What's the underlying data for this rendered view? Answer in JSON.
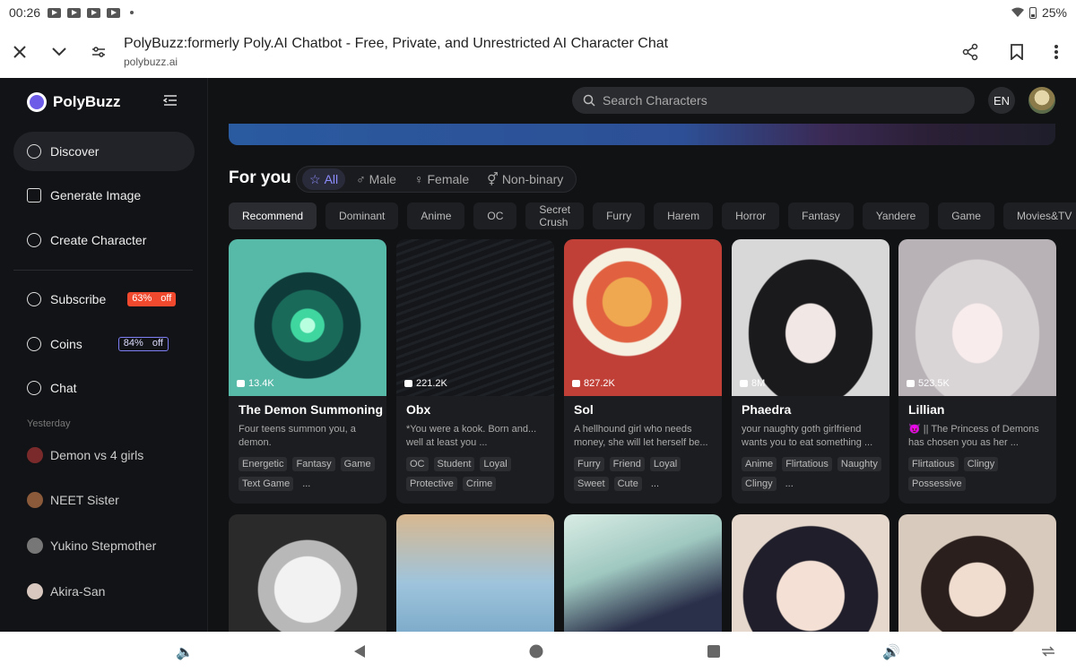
{
  "statusbar": {
    "time": "00:26",
    "battery": "25%"
  },
  "browser": {
    "title": "PolyBuzz:formerly Poly.AI Chatbot - Free, Private, and Unrestricted AI Character Chat",
    "domain": "polybuzz.ai"
  },
  "sidebar": {
    "logo": "PolyBuzz",
    "nav": [
      {
        "label": "Discover",
        "icon": "compass-icon"
      },
      {
        "label": "Generate Image",
        "icon": "image-plus-icon"
      },
      {
        "label": "Create Character",
        "icon": "user-plus-icon"
      }
    ],
    "subscribe": {
      "label": "Subscribe",
      "badge_num": "63%",
      "badge_off": "off"
    },
    "coins": {
      "label": "Coins",
      "badge_num": "84%",
      "badge_off": "off"
    },
    "chat": {
      "label": "Chat"
    },
    "section_label": "Yesterday",
    "chats": [
      {
        "name": "Demon vs 4 girls",
        "color": "#7a2a2a"
      },
      {
        "name": "NEET Sister",
        "color": "#8a5a3a"
      },
      {
        "name": "Yukino Stepmother",
        "color": "#777777"
      },
      {
        "name": "Akira-San",
        "color": "#d8c8c0"
      }
    ]
  },
  "topbar": {
    "search_placeholder": "Search Characters",
    "lang": "EN"
  },
  "main": {
    "section_title": "For you",
    "gender_filters": [
      "All",
      "Male",
      "Female",
      "Non-binary"
    ],
    "tags": [
      "Recommend",
      "Dominant",
      "Anime",
      "OC",
      "Secret Crush",
      "Furry",
      "Harem",
      "Horror",
      "Fantasy",
      "Yandere",
      "Game",
      "Movies&TV"
    ],
    "cards": [
      {
        "name": "The Demon Summoning",
        "count": "13.4K",
        "desc": "Four teens summon you, a demon.",
        "tags": [
          "Energetic",
          "Fantasy",
          "Game",
          "Text Game"
        ],
        "more": "...",
        "bg": "#2a8a7a"
      },
      {
        "name": "Obx",
        "count": "221.2K",
        "desc": "*You were a kook. Born and... well at least you ...",
        "tags": [
          "OC",
          "Student",
          "Loyal",
          "Protective",
          "Crime"
        ],
        "more": "",
        "bg": "#1a1c1f"
      },
      {
        "name": "Sol",
        "count": "827.2K",
        "desc": "A hellhound girl who needs money, she will let herself be...",
        "tags": [
          "Furry",
          "Friend",
          "Loyal",
          "Sweet",
          "Cute"
        ],
        "more": "...",
        "bg": "#b24a3a"
      },
      {
        "name": "Phaedra",
        "count": "8M",
        "desc": "your naughty goth girlfriend wants you to eat something ...",
        "tags": [
          "Anime",
          "Flirtatious",
          "Naughty",
          "Clingy"
        ],
        "more": "...",
        "bg": "#cfcfcf"
      },
      {
        "name": "Lillian",
        "count": "523.5K",
        "desc": "😈 || The Princess of Demons has chosen you as her ...",
        "tags": [
          "Flirtatious",
          "Clingy",
          "Possessive"
        ],
        "more": "",
        "bg": "#e8e4e4"
      }
    ],
    "second_row_colors": [
      "#d9d9d9",
      "#c9a88a",
      "#cfe0d8",
      "#e8d8cc",
      "#e0d0c0"
    ]
  }
}
